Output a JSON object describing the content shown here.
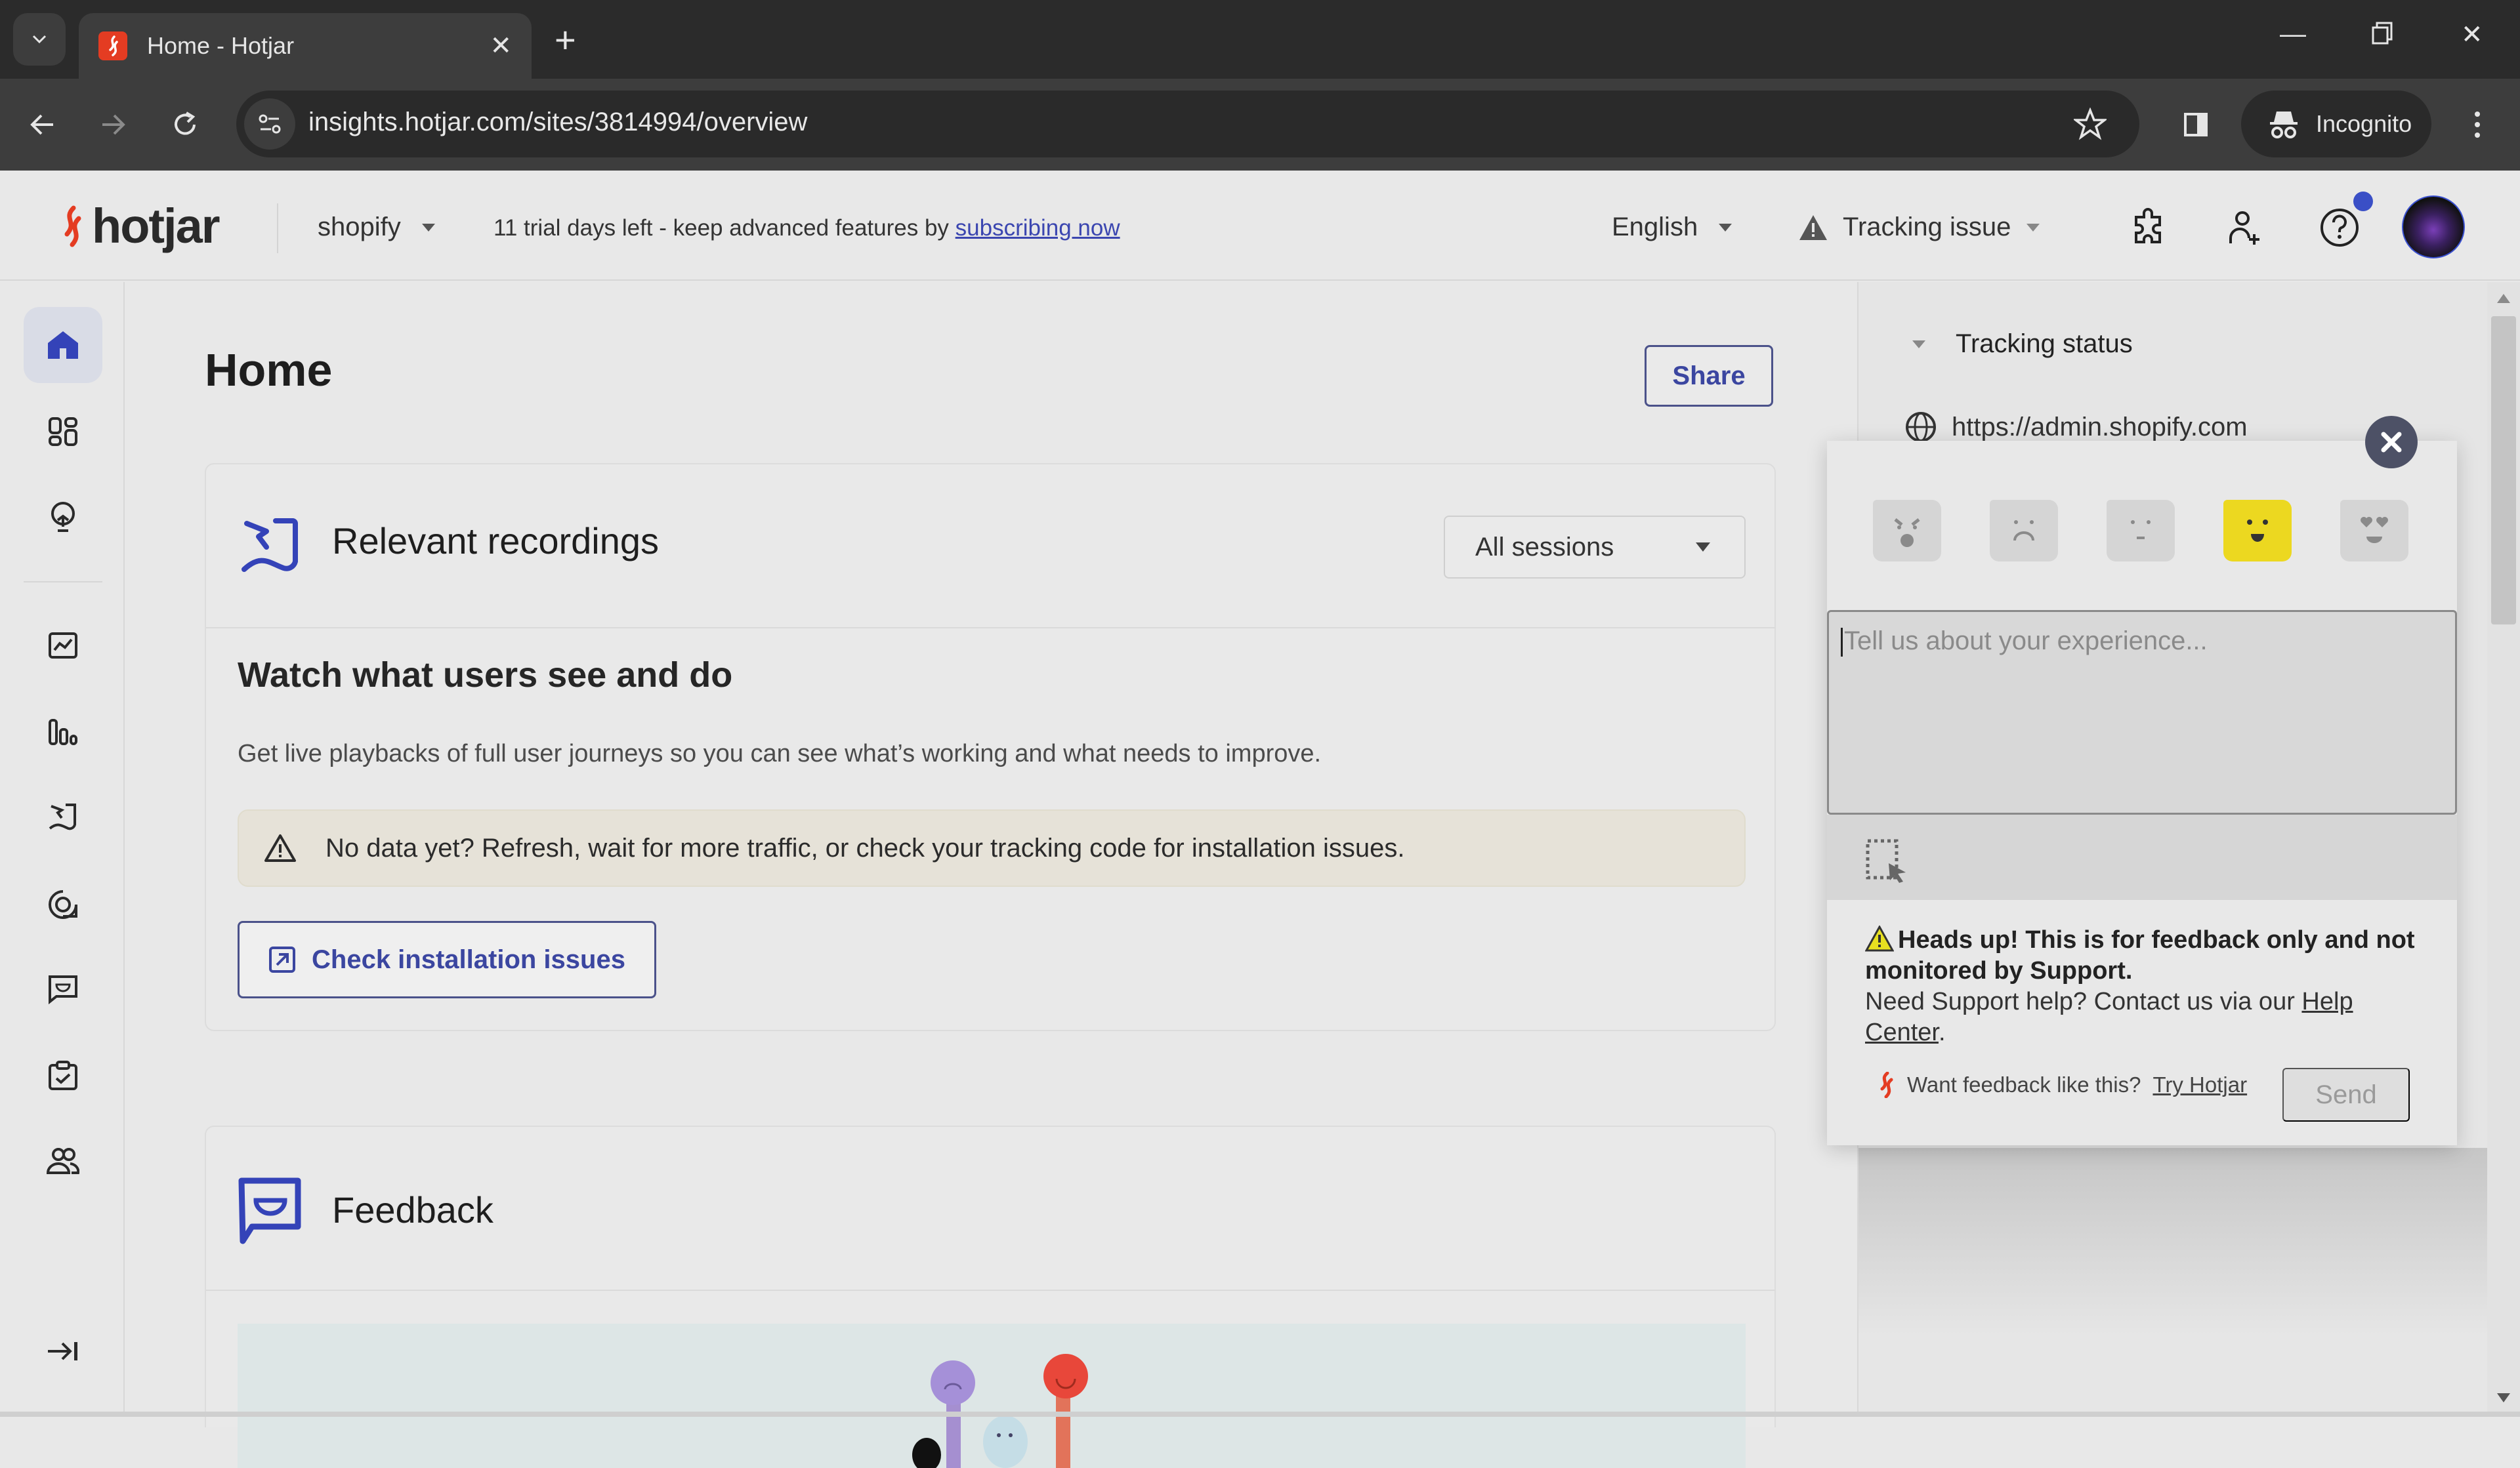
{
  "browser": {
    "tab_title": "Home - Hotjar",
    "url": "insights.hotjar.com/sites/3814994/overview",
    "incognito_label": "Incognito"
  },
  "header": {
    "logo_text": "hotjar",
    "site_name": "shopify",
    "trial_text": "11 trial days left - keep advanced features by ",
    "trial_link": "subscribing now",
    "language": "English",
    "tracking_status_label": "Tracking issue"
  },
  "sidebar": {
    "items": [
      {
        "name": "home",
        "label": "Home",
        "active": true
      },
      {
        "name": "dashboards",
        "label": "Dashboards"
      },
      {
        "name": "highlights",
        "label": "Highlights"
      },
      {
        "name": "trends",
        "label": "Trends"
      },
      {
        "name": "heatmaps",
        "label": "Heatmaps"
      },
      {
        "name": "recordings",
        "label": "Recordings"
      },
      {
        "name": "engage",
        "label": "Engage"
      },
      {
        "name": "feedback",
        "label": "Feedback"
      },
      {
        "name": "surveys",
        "label": "Surveys"
      },
      {
        "name": "users",
        "label": "Users"
      }
    ],
    "expand_label": "Expand sidebar"
  },
  "main": {
    "title": "Home",
    "share_label": "Share",
    "recordings": {
      "title": "Relevant recordings",
      "filter_value": "All sessions",
      "heading": "Watch what users see and do",
      "description": "Get live playbacks of full user journeys so you can see what’s working and what needs to improve.",
      "alert": "No data yet? Refresh, wait for more traffic, or check your tracking code for installation issues.",
      "check_button": "Check installation issues"
    },
    "feedback": {
      "title": "Feedback"
    }
  },
  "right_panel": {
    "tracking_status_title": "Tracking status",
    "site_url": "https://admin.shopify.com"
  },
  "feedback_widget": {
    "ratings": [
      "Hate",
      "Dislike",
      "Neutral",
      "Like",
      "Love"
    ],
    "selected_rating": "Like",
    "selected_label": "Like",
    "textarea_placeholder": "Tell us about your experience...",
    "notice_bold": "Heads up! This is for feedback only and not monitored by Support.",
    "notice_text": "Need Support help? Contact us via our ",
    "notice_link": "Help Center",
    "notice_end": ".",
    "footer_text": "Want feedback like this?",
    "footer_link": "Try Hotjar",
    "send_label": "Send"
  },
  "colors": {
    "brand_orange": "#e43c22",
    "accent_blue": "#3b46b0",
    "emoji_selected": "#ecd820"
  }
}
